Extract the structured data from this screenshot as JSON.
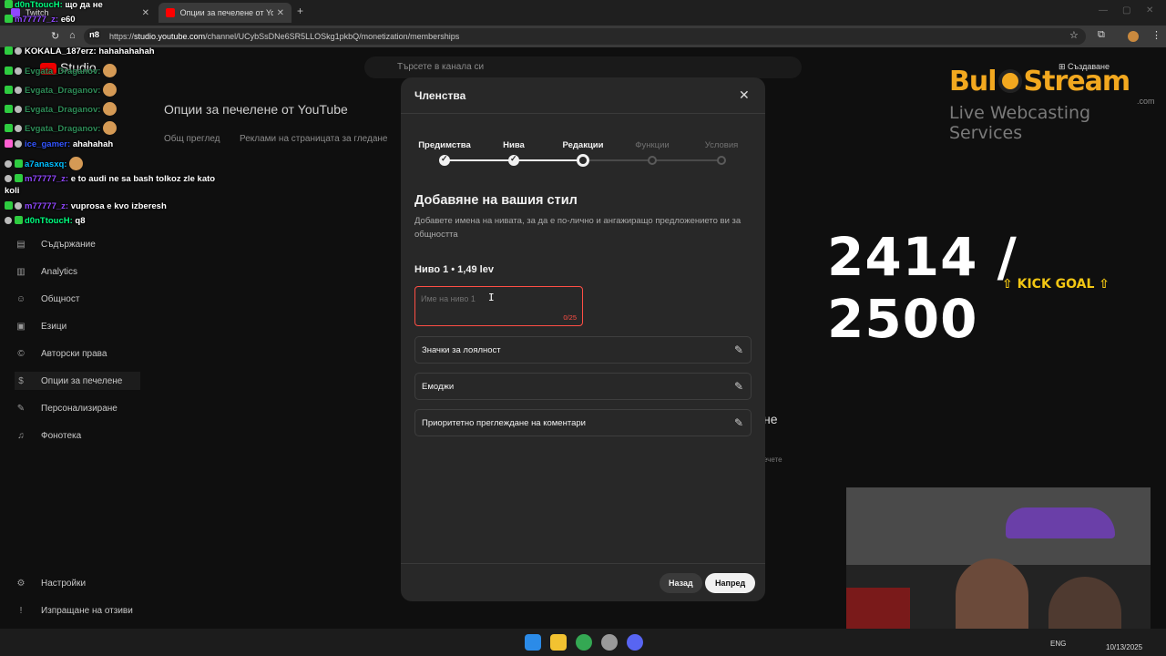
{
  "browser": {
    "tabs": [
      {
        "label": "Twitch",
        "active": false
      },
      {
        "label": "Опции за печелене от YouTub",
        "active": true
      }
    ],
    "new_tab_label": "+",
    "url_prefix": "https://",
    "url_host": "studio.youtube.com",
    "url_path": "/channel/UCybSsDNe6SR5LLOSkg1pkbQ/monetization/memberships",
    "accent_color": "#ff0000"
  },
  "studio": {
    "logo_text": "Studio",
    "search_placeholder": "Търсете в канала си",
    "create_label": "Създаване",
    "page_title": "Опции за печелене от YouTube",
    "page_tabs": [
      "Общ преглед",
      "Реклами на страницата за гледане"
    ],
    "sidebar": [
      {
        "label": "Съдържание",
        "icon": "content-icon",
        "glyph": "▤"
      },
      {
        "label": "Analytics",
        "icon": "analytics-icon",
        "glyph": "▥"
      },
      {
        "label": "Общност",
        "icon": "community-icon",
        "glyph": "☺"
      },
      {
        "label": "Езици",
        "icon": "languages-icon",
        "glyph": "▣"
      },
      {
        "label": "Авторски права",
        "icon": "copyright-icon",
        "glyph": "©"
      },
      {
        "label": "Опции за печелене",
        "icon": "dollar-icon",
        "glyph": "$",
        "active": true
      },
      {
        "label": "Персонализиране",
        "icon": "customization-icon",
        "glyph": "✎"
      },
      {
        "label": "Фонотека",
        "icon": "audio-library-icon",
        "glyph": "♫"
      }
    ],
    "sidebar_bottom": [
      {
        "label": "Настройки",
        "icon": "settings-icon",
        "glyph": "⚙"
      },
      {
        "label": "Изпращане на отзиви",
        "icon": "feedback-icon",
        "glyph": "!"
      }
    ],
    "bg_fragment": "не",
    "bg_fragment_small": "ечете"
  },
  "modal": {
    "title": "Членства",
    "steps": [
      {
        "label": "Предимства",
        "state": "done"
      },
      {
        "label": "Нива",
        "state": "done"
      },
      {
        "label": "Редакции",
        "state": "current"
      },
      {
        "label": "Функции",
        "state": "pending"
      },
      {
        "label": "Условия",
        "state": "pending"
      }
    ],
    "section_title": "Добавяне на вашия стил",
    "section_desc": "Добавете имена на нивата, за да е по-лично и ангажиращо предложението ви за общността",
    "tier_label": "Ниво 1 • 1,49 lev",
    "tier_input_placeholder": "Име на ниво 1",
    "tier_input_value": "",
    "tier_counter": "0/25",
    "perks": [
      {
        "label": "Значки за лоялност"
      },
      {
        "label": "Емоджи"
      },
      {
        "label": "Приоритетно преглеждане на коментари"
      }
    ],
    "back_label": "Назад",
    "next_label": "Напред"
  },
  "overlay": {
    "chat": [
      {
        "user": "d0nTtoucH:",
        "msg": "що да не",
        "color": "#00ff7f"
      },
      {
        "user": "m77777_z:",
        "msg": "e60",
        "color": "#9147ff"
      },
      {
        "user": "",
        "msg": "n8",
        "color": "#ffffff"
      },
      {
        "user": "KOKALA_187erz:",
        "msg": "hahahahahah",
        "color": "#ffffff"
      },
      {
        "user": "Evgata_Draganov:",
        "msg": "",
        "color": "#2e8b57",
        "emote": true
      },
      {
        "user": "Evgata_Draganov:",
        "msg": "",
        "color": "#2e8b57",
        "emote": true
      },
      {
        "user": "Evgata_Draganov:",
        "msg": "",
        "color": "#2e8b57",
        "emote": true
      },
      {
        "user": "Evgata_Draganov:",
        "msg": "",
        "color": "#2e8b57",
        "emote": true
      },
      {
        "user": "ice_gamer:",
        "msg": "ahahahah",
        "color": "#3355ff"
      },
      {
        "user": "a7anasxq:",
        "msg": "",
        "color": "#00bfff",
        "emote": true
      },
      {
        "user": "m77777_z:",
        "msg": "e to audi ne sa bash tolkoz zle kato",
        "color": "#9147ff"
      },
      {
        "user": "",
        "msg": "koli",
        "color": "#ffffff"
      },
      {
        "user": "m77777_z:",
        "msg": "vuprosa e kvo izberesh",
        "color": "#9147ff"
      },
      {
        "user": "d0nTtoucH:",
        "msg": "q8",
        "color": "#00ff7f"
      }
    ],
    "brand_left": "Bul",
    "brand_right": "Stream",
    "brand_tld": ".com",
    "brand_sub": "Live Webcasting Services",
    "brand_color": "#f2a81f",
    "goal_current": "2414",
    "goal_total": "2500",
    "goal_label": "KICK GOAL",
    "goal_fraction": 0.9656
  },
  "taskbar": {
    "lang": "ENG",
    "date": "10/13/2025"
  }
}
